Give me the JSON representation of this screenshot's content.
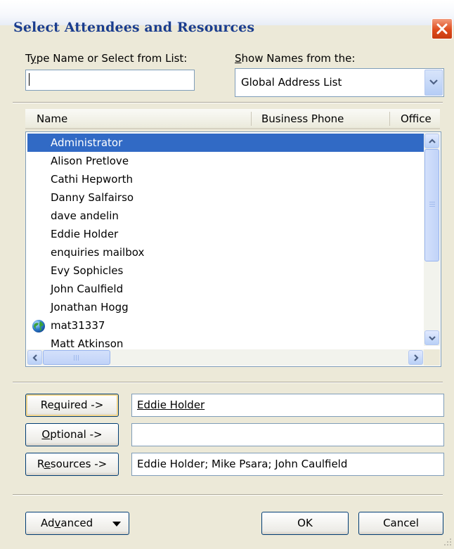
{
  "dialog": {
    "title": "Select Attendees and Resources"
  },
  "search": {
    "label_prefix": "T",
    "label_accel": "y",
    "label_rest": "pe Name or Select from List:",
    "value": ""
  },
  "source": {
    "label_accel": "S",
    "label_rest": "how Names from the:",
    "selected": "Global Address List"
  },
  "columns": [
    "Name",
    "Business Phone",
    "Office"
  ],
  "contacts": [
    {
      "name": "Administrator",
      "selected": true,
      "icon": ""
    },
    {
      "name": "Alison Pretlove",
      "selected": false,
      "icon": ""
    },
    {
      "name": "Cathi Hepworth",
      "selected": false,
      "icon": ""
    },
    {
      "name": "Danny Salfairso",
      "selected": false,
      "icon": ""
    },
    {
      "name": "dave andelin",
      "selected": false,
      "icon": ""
    },
    {
      "name": "Eddie Holder",
      "selected": false,
      "icon": ""
    },
    {
      "name": "enquiries mailbox",
      "selected": false,
      "icon": ""
    },
    {
      "name": "Evy Sophicles",
      "selected": false,
      "icon": ""
    },
    {
      "name": "John Caulfield",
      "selected": false,
      "icon": ""
    },
    {
      "name": "Jonathan Hogg",
      "selected": false,
      "icon": ""
    },
    {
      "name": "mat31337",
      "selected": false,
      "icon": "globe-icon"
    },
    {
      "name": "Matt Atkinson",
      "selected": false,
      "icon": ""
    }
  ],
  "buttons": {
    "required": {
      "pre": "Re",
      "accel": "q",
      "post": "uired ->"
    },
    "optional": {
      "pre": "",
      "accel": "O",
      "post": "ptional ->"
    },
    "resources": {
      "pre": "R",
      "accel": "e",
      "post": "sources ->"
    },
    "advanced": {
      "pre": "Ad",
      "accel": "v",
      "post": "anced"
    },
    "ok": "OK",
    "cancel": "Cancel"
  },
  "fields": {
    "required": "Eddie Holder",
    "optional": "",
    "resources": "Eddie Holder; Mike Psara; John Caulfield"
  },
  "colors": {
    "title_text": "#1a3d8f",
    "selection": "#316ac5",
    "dialog_bg": "#ece9d8",
    "close_button": "#de4b1c"
  }
}
